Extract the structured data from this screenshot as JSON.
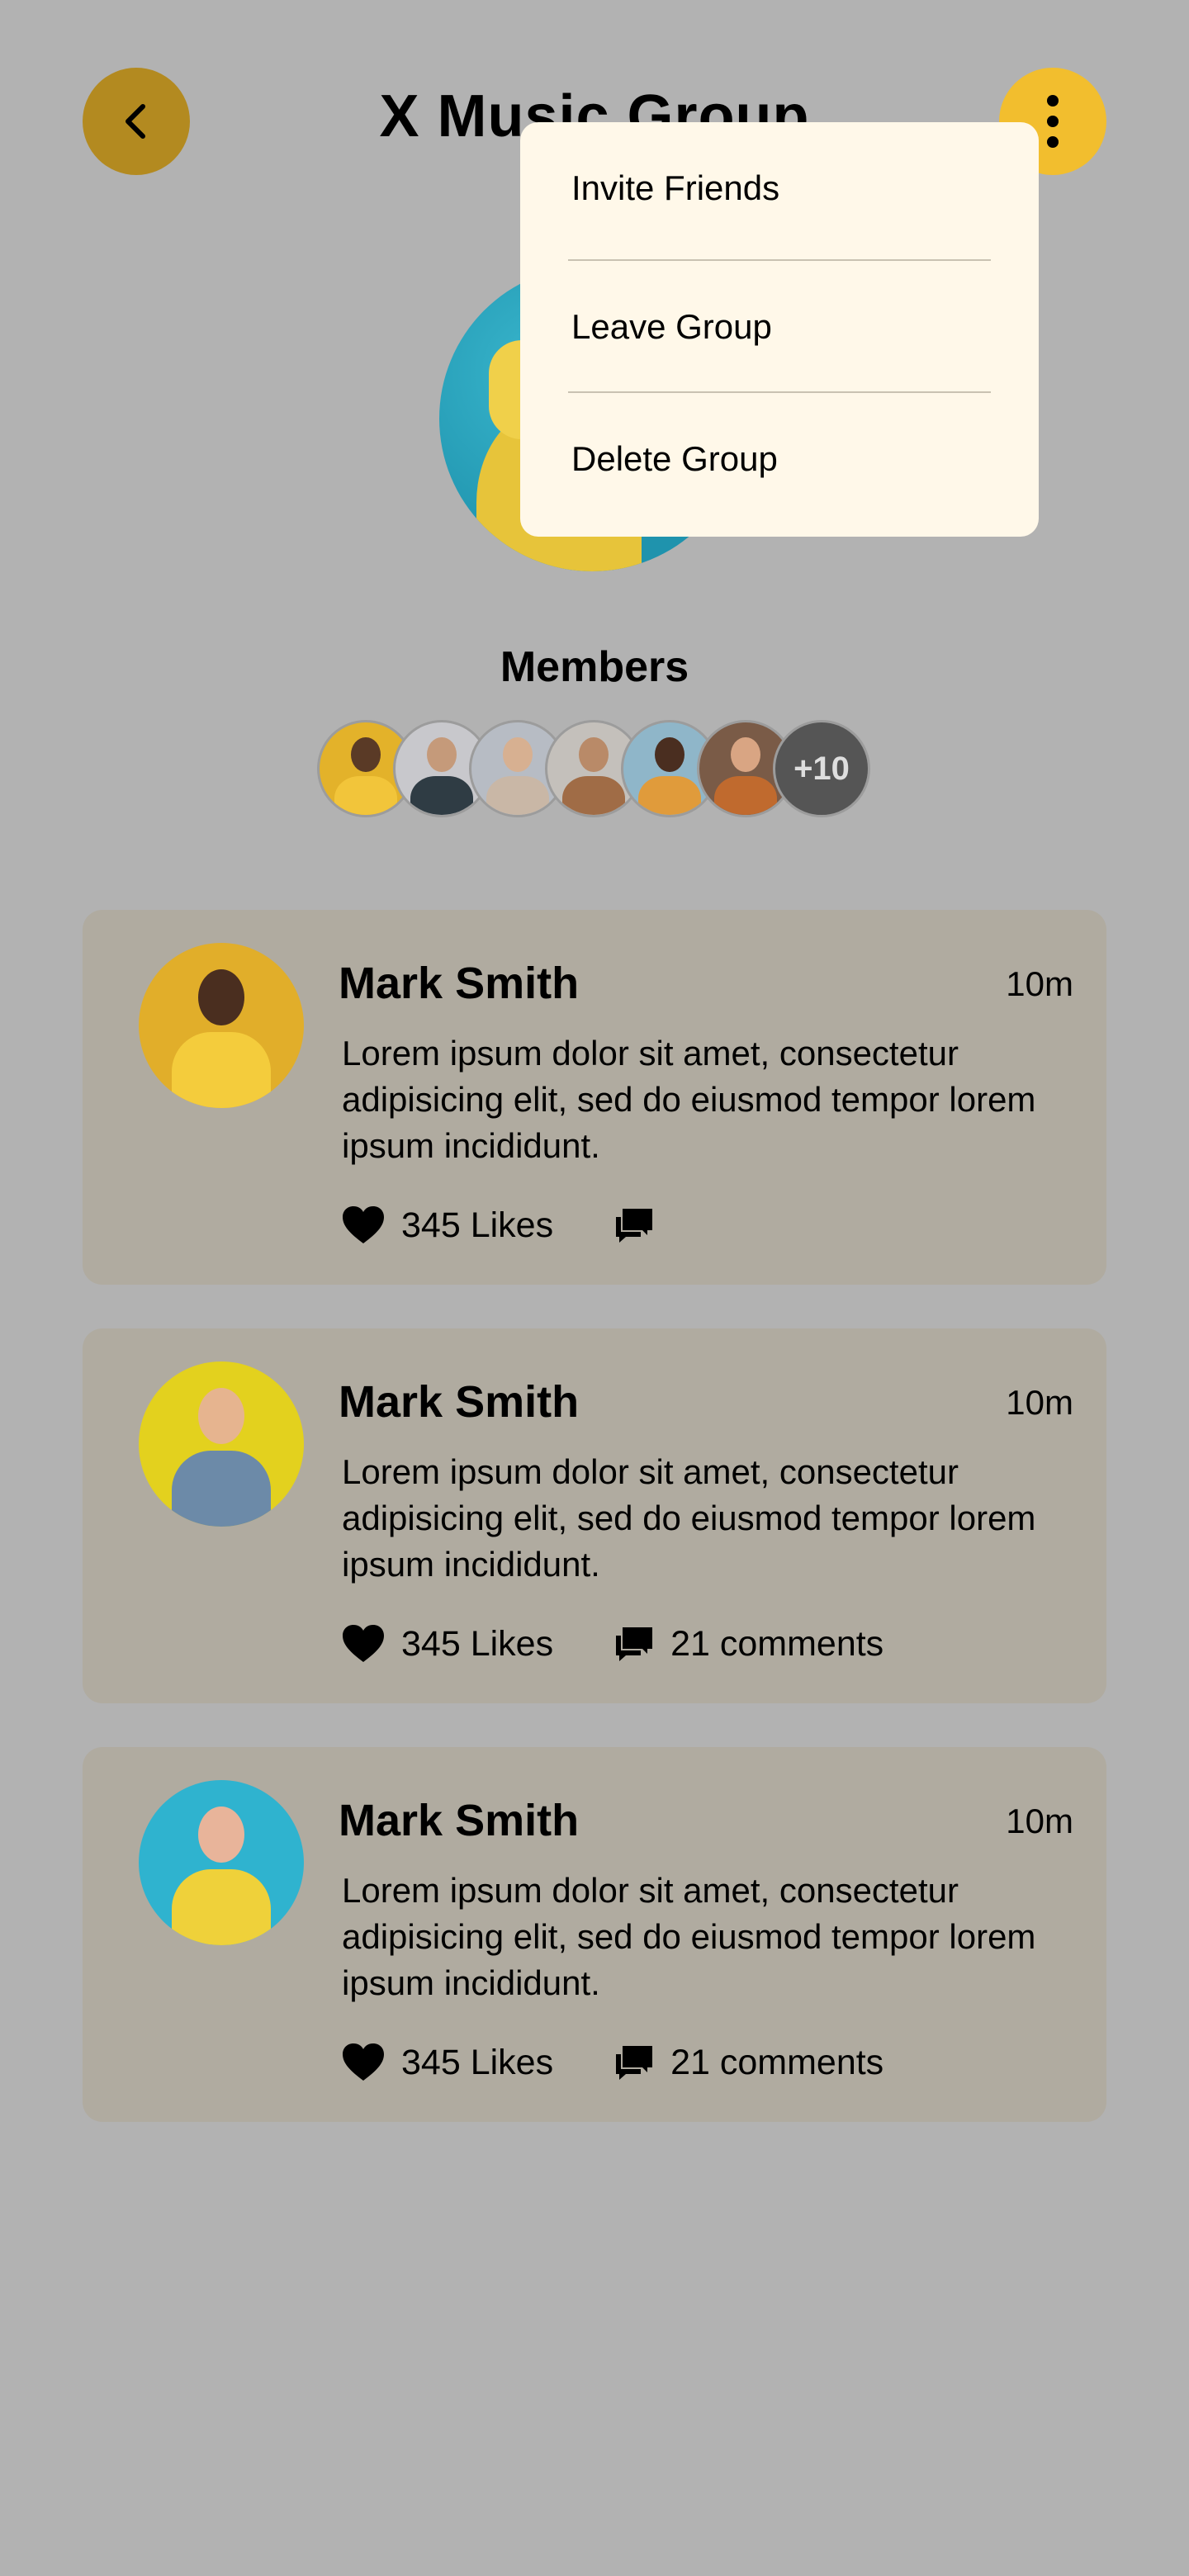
{
  "header": {
    "title": "X Music Group"
  },
  "colors": {
    "page_background": "#b2b2b2",
    "accent": "#f2be2e",
    "card_background": "#b0aba0",
    "menu_background": "#fff8e9"
  },
  "members": {
    "title": "Members",
    "more_count": "+10"
  },
  "posts": [
    {
      "name": "Mark Smith",
      "time": "10m",
      "text": "Lorem ipsum dolor sit amet, consectetur adipisicing elit, sed do eiusmod tempor lorem ipsum incididunt.",
      "likes": "345 Likes",
      "comments": ""
    },
    {
      "name": "Mark Smith",
      "time": "10m",
      "text": "Lorem ipsum dolor sit amet, consectetur adipisicing elit, sed do eiusmod tempor lorem ipsum incididunt.",
      "likes": "345 Likes",
      "comments": "21 comments"
    },
    {
      "name": "Mark Smith",
      "time": "10m",
      "text": "Lorem ipsum dolor sit amet, consectetur adipisicing elit, sed do eiusmod tempor lorem ipsum incididunt.",
      "likes": "345 Likes",
      "comments": "21 comments"
    }
  ],
  "menu": {
    "items": [
      {
        "label": "Invite Friends"
      },
      {
        "label": "Leave Group"
      },
      {
        "label": "Delete Group"
      }
    ]
  },
  "icons": {
    "back": "chevron-left-icon",
    "more": "more-vertical-icon",
    "like": "heart-icon",
    "comment": "comment-icon"
  }
}
